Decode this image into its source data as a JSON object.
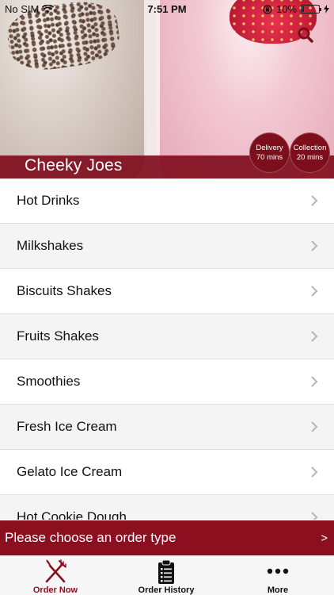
{
  "status_bar": {
    "carrier": "No SIM",
    "time": "7:51 PM",
    "battery": "10%",
    "battery_level": 0.1
  },
  "header": {
    "restaurant_name": "Cheeky Joes",
    "search_icon": "search-icon",
    "delivery": {
      "label": "Delivery",
      "time": "70 mins"
    },
    "collection": {
      "label": "Collection",
      "time": "20 mins"
    }
  },
  "menu": {
    "items": [
      {
        "label": "Hot Drinks"
      },
      {
        "label": "Milkshakes"
      },
      {
        "label": "Biscuits Shakes"
      },
      {
        "label": "Fruits Shakes"
      },
      {
        "label": "Smoothies"
      },
      {
        "label": "Fresh Ice Cream"
      },
      {
        "label": "Gelato Ice Cream"
      },
      {
        "label": "Hot Cookie Dough"
      }
    ]
  },
  "order_bar": {
    "text": "Please choose an order type",
    "arrow": ">"
  },
  "tabs": [
    {
      "label": "Order Now",
      "icon": "fork-knife-icon",
      "active": true
    },
    {
      "label": "Order History",
      "icon": "clipboard-list-icon",
      "active": false
    },
    {
      "label": "More",
      "icon": "more-dots-icon",
      "active": false
    }
  ],
  "colors": {
    "brand": "#8b0f1e",
    "list_alt": "#f4f4f4"
  }
}
